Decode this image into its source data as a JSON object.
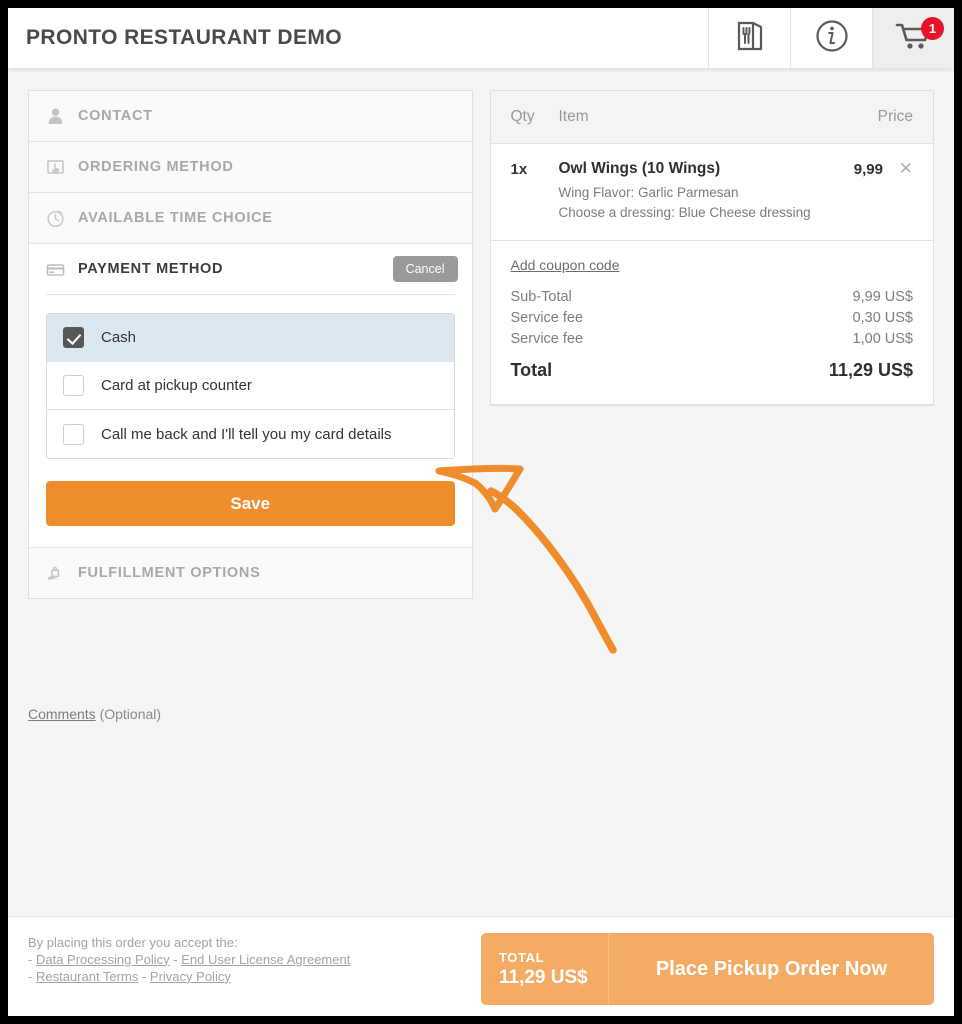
{
  "header": {
    "title": "PRONTO RESTAURANT DEMO",
    "menu_icon": "menu-book-icon",
    "info_icon": "info-circle-icon",
    "cart_icon": "shopping-cart-icon",
    "cart_count": "1"
  },
  "checkout": {
    "sections": [
      {
        "id": "contact",
        "label": "CONTACT",
        "icon": "person-icon",
        "open": false
      },
      {
        "id": "ordering",
        "label": "ORDERING METHOD",
        "icon": "hand-screen-icon",
        "open": false
      },
      {
        "id": "time",
        "label": "AVAILABLE TIME CHOICE",
        "icon": "clock-icon",
        "open": false
      },
      {
        "id": "payment",
        "label": "PAYMENT METHOD",
        "icon": "credit-card-icon",
        "open": true
      },
      {
        "id": "fulfillment",
        "label": "FULFILLMENT OPTIONS",
        "icon": "shopping-bag-icon",
        "open": false
      }
    ],
    "cancel_label": "Cancel",
    "save_label": "Save",
    "payment_options": [
      {
        "label": "Cash",
        "checked": true
      },
      {
        "label": "Card at pickup counter",
        "checked": false
      },
      {
        "label": "Call me back and I'll tell you my card details",
        "checked": false
      }
    ],
    "comments_link": "Comments",
    "comments_note": "(Optional)"
  },
  "cart": {
    "columns": {
      "qty": "Qty",
      "item": "Item",
      "price": "Price"
    },
    "items": [
      {
        "qty": "1x",
        "name": "Owl Wings (10 Wings)",
        "options": [
          "Wing Flavor: Garlic Parmesan",
          "Choose a dressing: Blue Cheese dressing"
        ],
        "price": "9,99",
        "remove_icon": "close-icon"
      }
    ],
    "coupon_link": "Add coupon code",
    "totals": [
      {
        "label": "Sub-Total",
        "value": "9,99 US$"
      },
      {
        "label": "Service fee",
        "value": "0,30 US$"
      },
      {
        "label": "Service fee",
        "value": "1,00 US$"
      }
    ],
    "grand_total": {
      "label": "Total",
      "value": "11,29 US$"
    }
  },
  "footer": {
    "legal_intro": "By placing this order you accept the:",
    "legal_dash": "-",
    "links_line1": [
      "Data Processing Policy",
      "End User License Agreement"
    ],
    "links_line2": [
      "Restaurant Terms",
      "Privacy Policy"
    ],
    "order_button": {
      "total_label": "TOTAL",
      "total_value": "11,29 US$",
      "cta": "Place Pickup Order Now"
    }
  },
  "annotation": {
    "type": "arrow",
    "color": "#ef8c2c",
    "points_to": "payment-options-list"
  },
  "colors": {
    "accent_orange": "#ef8c2c",
    "order_button_orange": "#f4ab64",
    "badge_red": "#e8132a",
    "selected_row_blue": "#dce8f0",
    "checkbox_checked": "#575757",
    "cancel_gray": "#9a9a9a"
  }
}
